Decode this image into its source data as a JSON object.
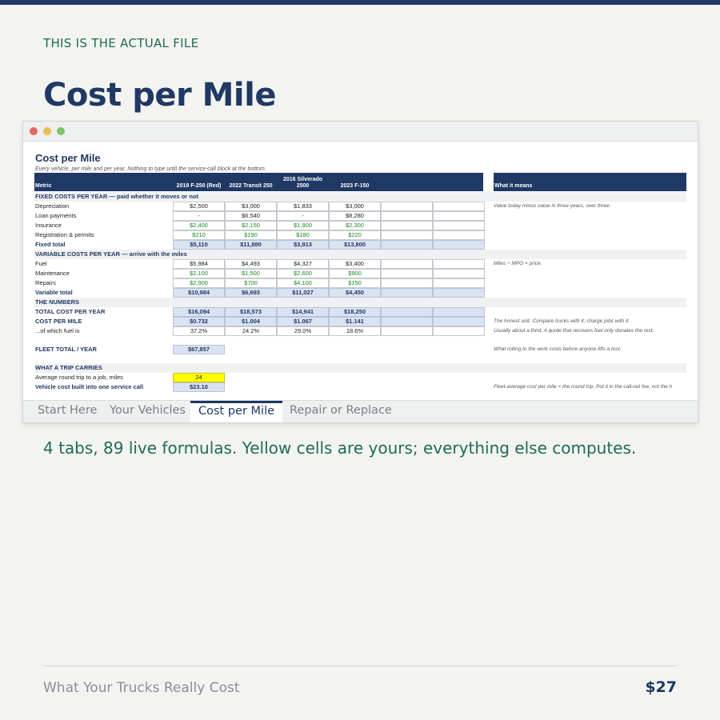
{
  "eyebrow": "THIS IS THE ACTUAL FILE",
  "headline": "Cost per Mile",
  "sheet": {
    "title": "Cost per Mile",
    "subtitle": "Every vehicle, per mile and per year. Nothing to type until the service-call block at the bottom.",
    "headers": [
      "Metric",
      "2019 F-250 (Red)",
      "2022 Transit 250",
      "2016 Silverado 2500",
      "2023 F-150",
      "What it means"
    ],
    "sections": {
      "fixed": "FIXED COSTS PER YEAR — paid whether it moves or not",
      "variable": "VARIABLE COSTS PER YEAR — arrive with the miles",
      "numbers": "THE NUMBERS",
      "trip": "WHAT A TRIP CARRIES"
    },
    "rows": {
      "depreciation": {
        "label": "Depreciation",
        "v": [
          "$2,500",
          "$3,000",
          "$1,833",
          "$3,000"
        ],
        "note": "Value today minus value in three years, over three."
      },
      "loan": {
        "label": "Loan payments",
        "v": [
          "-",
          "$6,540",
          "-",
          "$8,280"
        ]
      },
      "insurance": {
        "label": "Insurance",
        "v": [
          "$2,400",
          "$2,150",
          "$1,900",
          "$2,300"
        ]
      },
      "registration": {
        "label": "Registration & permits",
        "v": [
          "$210",
          "$190",
          "$180",
          "$220"
        ]
      },
      "fixed_total": {
        "label": "Fixed total",
        "v": [
          "$5,110",
          "$11,880",
          "$3,913",
          "$13,800"
        ]
      },
      "fuel": {
        "label": "Fuel",
        "v": [
          "$5,984",
          "$4,493",
          "$4,327",
          "$3,400"
        ],
        "note": "Miles ÷ MPG × price."
      },
      "maintenance": {
        "label": "Maintenance",
        "v": [
          "$2,100",
          "$1,500",
          "$2,600",
          "$900"
        ]
      },
      "repairs": {
        "label": "Repairs",
        "v": [
          "$2,900",
          "$700",
          "$4,100",
          "$150"
        ]
      },
      "variable_total": {
        "label": "Variable total",
        "v": [
          "$10,984",
          "$6,693",
          "$11,027",
          "$4,450"
        ]
      },
      "total_cost": {
        "label": "TOTAL COST PER YEAR",
        "v": [
          "$16,094",
          "$18,573",
          "$14,941",
          "$18,250"
        ]
      },
      "cpm": {
        "label": "COST PER MILE",
        "v": [
          "$0.732",
          "$1.004",
          "$1.067",
          "$1.141"
        ],
        "note": "The honest unit. Compare trucks with it; charge jobs with it."
      },
      "fuel_share": {
        "label": "...of which fuel is",
        "v": [
          "37.2%",
          "24.2%",
          "29.0%",
          "18.6%"
        ],
        "note": "Usually about a third. A quote that recovers fuel only donates the rest."
      },
      "fleet": {
        "label": "FLEET TOTAL / YEAR",
        "v": [
          "$67,857"
        ],
        "note": "What rolling to the work costs before anyone lifts a tool."
      },
      "round_trip": {
        "label": "Average round trip to a job, miles",
        "v": [
          "24"
        ]
      },
      "service_call": {
        "label": "Vehicle cost built into one service call",
        "v": [
          "$23.10"
        ],
        "note": "Fleet-average cost per mile × the round trip. Put it in the call-out fee, not the h"
      }
    }
  },
  "tabs": [
    "Start Here",
    "Your Vehicles",
    "Cost per Mile",
    "Repair or Replace"
  ],
  "tagline": "4 tabs, 89 live formulas. Yellow cells are yours; everything else computes.",
  "footer": {
    "product": "What Your Trucks Really Cost",
    "price": "$27"
  },
  "colors": {
    "navy": "#1f3864",
    "green_text": "#1e6b52",
    "input_yellow": "#ffff00",
    "total_fill": "#dae3f3"
  }
}
